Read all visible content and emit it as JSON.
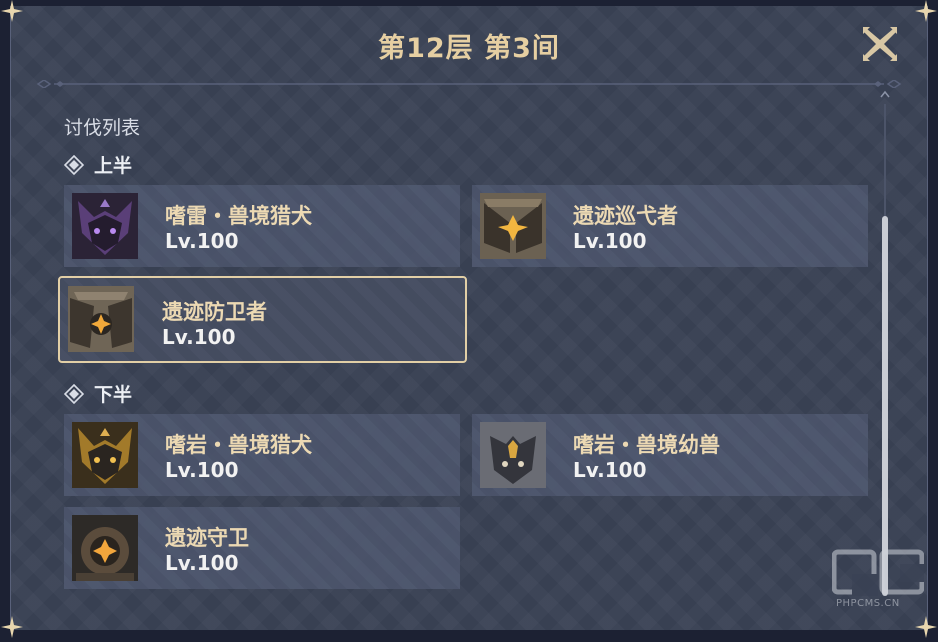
{
  "title": "第12层 第3间",
  "section_label": "讨伐列表",
  "halves": [
    {
      "label": "上半",
      "enemies": [
        {
          "name": "嗜雷・兽境猎犬",
          "level": "Lv.100",
          "icon": "electro-rifthound-portrait"
        },
        {
          "name": "遗迹巡弋者",
          "level": "Lv.100",
          "icon": "ruin-drake-portrait"
        },
        {
          "name": "遗迹防卫者",
          "level": "Lv.100",
          "icon": "ruin-defender-portrait"
        }
      ]
    },
    {
      "label": "下半",
      "enemies": [
        {
          "name": "嗜岩・兽境猎犬",
          "level": "Lv.100",
          "icon": "geo-rifthound-portrait"
        },
        {
          "name": "嗜岩・兽境幼兽",
          "level": "Lv.100",
          "icon": "geo-rifthound-whelp-portrait"
        },
        {
          "name": "遗迹守卫",
          "level": "Lv.100",
          "icon": "ruin-guard-portrait"
        }
      ]
    }
  ],
  "selected_enemy": "遗迹防卫者",
  "watermark": {
    "logo": "PC",
    "text": "PHPCMS.CN"
  },
  "colors": {
    "panel_bg": "#3a4255",
    "title_gold": "#e6cfa2",
    "name_gold": "#ecd9b3",
    "card_bg": "#4d576e",
    "selected_border": "#e2cfa6"
  }
}
